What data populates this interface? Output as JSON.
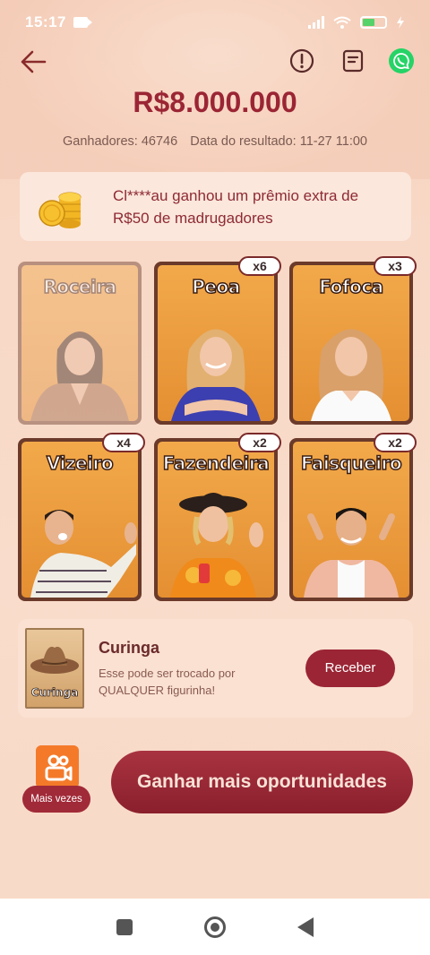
{
  "status_bar": {
    "time": "15:17",
    "battery_level": ""
  },
  "prize": {
    "amount": "R$8.000.000"
  },
  "meta": {
    "winners": "Ganhadores: 46746",
    "result_date": "Data do resultado: 11-27 11:00"
  },
  "notice": {
    "line1": "Cl****au ganhou um prêmio extra de",
    "line2": "R$50 de madrugadores"
  },
  "cards": [
    {
      "title": "Roceira",
      "badge": ""
    },
    {
      "title": "Peoa",
      "badge": "x6"
    },
    {
      "title": "Fofoca",
      "badge": "x3"
    },
    {
      "title": "Vizeiro",
      "badge": "x4"
    },
    {
      "title": "Fazendeira",
      "badge": "x2"
    },
    {
      "title": "Faisqueiro",
      "badge": "x2"
    }
  ],
  "wild": {
    "title": "Curinga",
    "desc": "Esse pode ser trocado por QUALQUER figurinha!",
    "img_label": "Curinga",
    "button": "Receber"
  },
  "more": {
    "label": "Mais vezes"
  },
  "main_button": "Ganhar mais oportunidades",
  "colors": {
    "accent": "#9b2534",
    "card_bg": "#e48f32",
    "whatsapp": "#25d366"
  }
}
